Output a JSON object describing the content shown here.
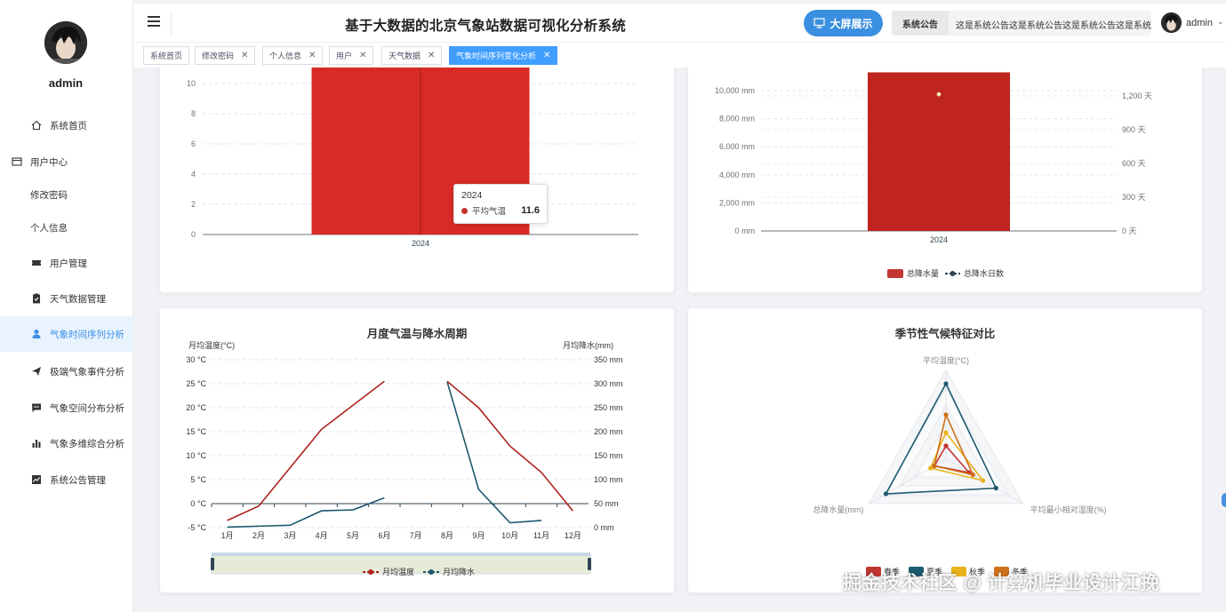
{
  "sidebar": {
    "username": "admin",
    "items": [
      {
        "label": "系统首页",
        "icon": "home-icon"
      },
      {
        "label": "用户中心",
        "icon": "user-center-icon"
      },
      {
        "label": "修改密码",
        "icon": ""
      },
      {
        "label": "个人信息",
        "icon": ""
      },
      {
        "label": "用户管理",
        "icon": "ticket-icon"
      },
      {
        "label": "天气数据管理",
        "icon": "clipboard-icon"
      },
      {
        "label": "气象时间序列分析",
        "icon": "person-icon"
      },
      {
        "label": "极端气象事件分析",
        "icon": "send-icon"
      },
      {
        "label": "气象空间分布分析",
        "icon": "message-icon"
      },
      {
        "label": "气象多维综合分析",
        "icon": "bar-chart-icon"
      },
      {
        "label": "系统公告管理",
        "icon": "line-chart-icon"
      }
    ]
  },
  "header": {
    "title": "基于大数据的北京气象站数据可视化分析系统",
    "bigscreen_label": "大屏展示",
    "notice_label": "系统公告",
    "notice_text": "这是系统公告这是系统公告这是系统公告这是系统公告",
    "user": "admin"
  },
  "tabs": [
    {
      "label": "系统首页",
      "closable": false
    },
    {
      "label": "修改密码",
      "closable": true
    },
    {
      "label": "个人信息",
      "closable": true
    },
    {
      "label": "用户",
      "closable": true
    },
    {
      "label": "天气数据",
      "closable": true
    },
    {
      "label": "气象时间序列变化分析",
      "closable": true
    }
  ],
  "tooltip": {
    "title": "2024",
    "name": "平均气温",
    "value": "11.6"
  },
  "colors": {
    "accent": "#409eff",
    "red": "#c23531",
    "teal": "#2f4554",
    "sidebar_active_bg": "#e8f3fd"
  },
  "watermark": "掘金技术社区 @ 计算机毕业设计江挽",
  "chart_data": [
    {
      "type": "bar",
      "categories": [
        "2024"
      ],
      "series": [
        {
          "name": "平均气温",
          "values": [
            11.6
          ]
        }
      ],
      "yticks": [
        "0",
        "2",
        "4",
        "6",
        "8",
        "10"
      ]
    },
    {
      "type": "bar",
      "categories": [
        "2024"
      ],
      "series": [
        {
          "name": "总降水量",
          "values": [
            11300
          ]
        },
        {
          "name": "总降水日数",
          "values": [
            1215
          ]
        }
      ],
      "y_left_ticks": [
        "0 mm",
        "2,000 mm",
        "4,000 mm",
        "6,000 mm",
        "8,000 mm",
        "10,000 mm"
      ],
      "y_right_ticks": [
        "0 天",
        "300 天",
        "600 天",
        "900 天",
        "1,200 天"
      ],
      "legend": [
        "总降水量",
        "总降水日数"
      ]
    },
    {
      "type": "line",
      "title": "月度气温与降水周期",
      "ylabel_left": "月均温度(°C)",
      "ylabel_right": "月均降水(mm)",
      "categories": [
        "1月",
        "2月",
        "3月",
        "4月",
        "5月",
        "6月",
        "7月",
        "8月",
        "9月",
        "10月",
        "11月",
        "12月"
      ],
      "y_left_ticks": [
        "-5 °C",
        "0 °C",
        "5 °C",
        "10 °C",
        "15 °C",
        "20 °C",
        "25 °C",
        "30 °C"
      ],
      "y_right_ticks": [
        "0 mm",
        "50 mm",
        "100 mm",
        "150 mm",
        "200 mm",
        "250 mm",
        "300 mm",
        "350 mm"
      ],
      "series": [
        {
          "name": "月均温度",
          "values": [
            -3.5,
            -0.5,
            7.5,
            15.5,
            20.5,
            25.5,
            null,
            25.5,
            20,
            12,
            6.5,
            -1.5
          ]
        },
        {
          "name": "月均降水",
          "values": [
            1,
            3,
            5,
            35,
            37,
            62,
            null,
            304,
            80,
            10,
            15,
            null
          ]
        }
      ],
      "legend": [
        "月均温度",
        "月均降水"
      ]
    },
    {
      "type": "radar",
      "title": "季节性气候特征对比",
      "indicators": [
        "平均温度(°C)",
        "平均最小相对湿度(%)",
        "总降水量(mm)"
      ],
      "series": [
        {
          "name": "春季",
          "values": [
            0.15,
            0.3,
            0.15
          ]
        },
        {
          "name": "夏季",
          "values": [
            0.85,
            0.65,
            0.78
          ]
        },
        {
          "name": "秋季",
          "values": [
            0.3,
            0.48,
            0.2
          ]
        },
        {
          "name": "冬季",
          "values": [
            0.5,
            0.35,
            0.15
          ]
        }
      ],
      "legend": [
        "春季",
        "夏季",
        "秋季",
        "冬季"
      ]
    }
  ]
}
